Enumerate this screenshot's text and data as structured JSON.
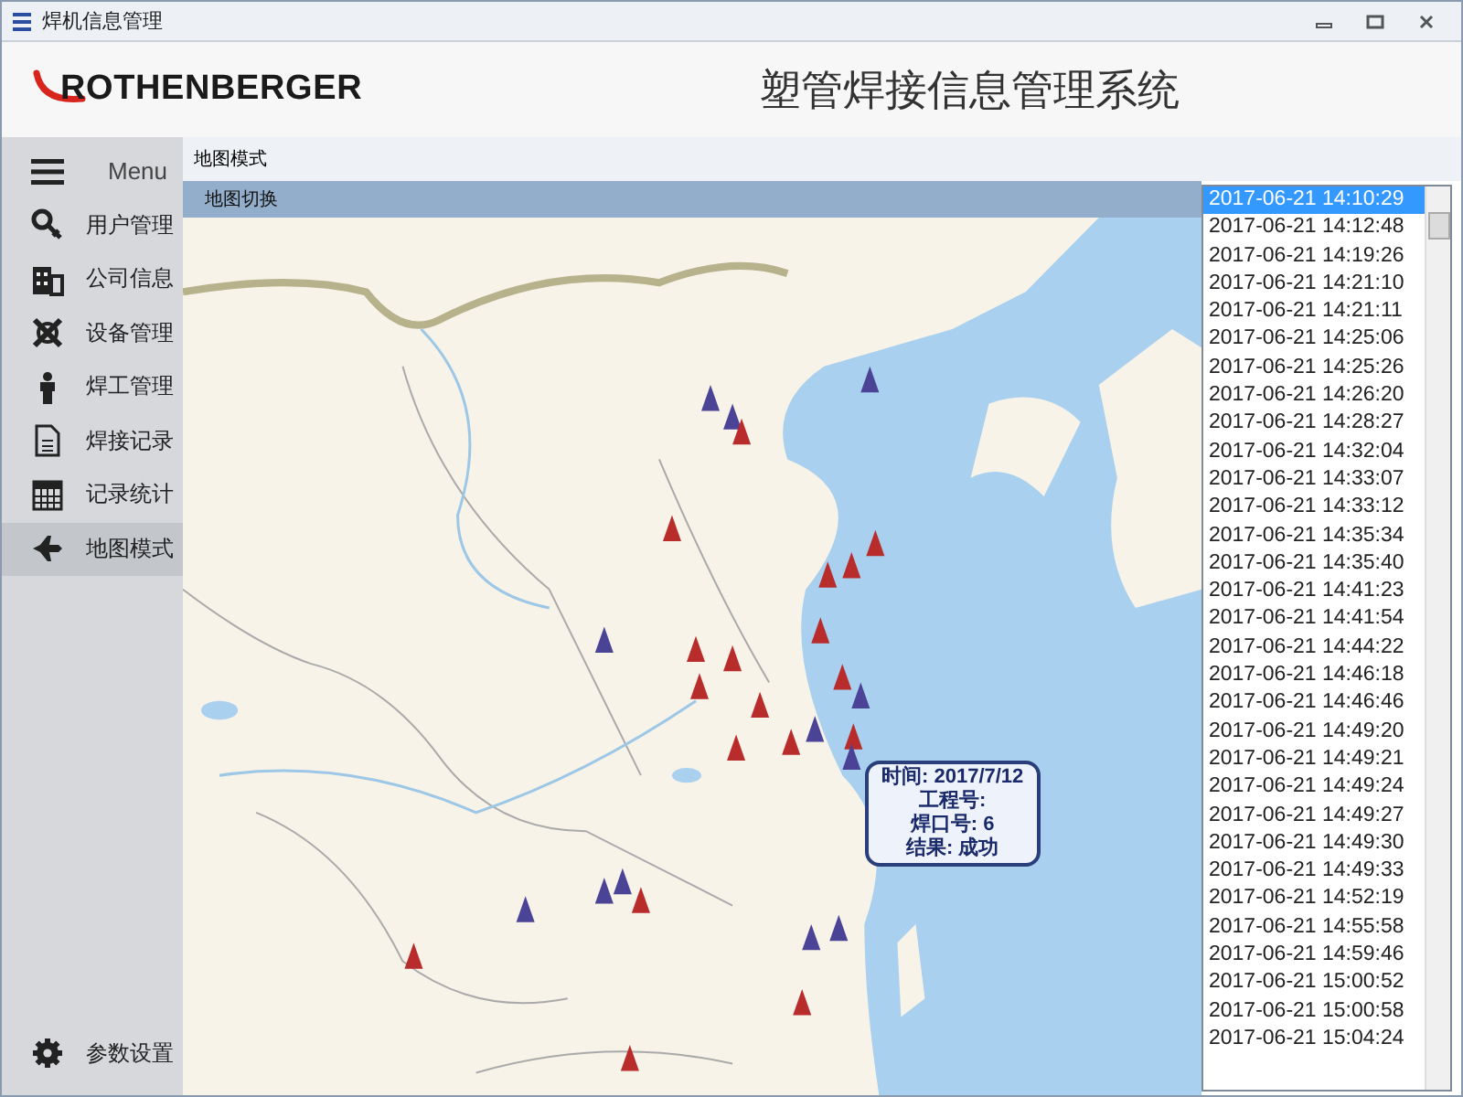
{
  "window": {
    "title": "焊机信息管理"
  },
  "header": {
    "logo": "ROTHENBERGER",
    "title": "塑管焊接信息管理系统"
  },
  "sidebar": {
    "menu_label": "Menu",
    "items": [
      {
        "label": "用户管理",
        "selected": false
      },
      {
        "label": "公司信息",
        "selected": false
      },
      {
        "label": "设备管理",
        "selected": false
      },
      {
        "label": "焊工管理",
        "selected": false
      },
      {
        "label": "焊接记录",
        "selected": false
      },
      {
        "label": "记录统计",
        "selected": false
      },
      {
        "label": "地图模式",
        "selected": true
      }
    ],
    "settings": "参数设置"
  },
  "content": {
    "breadcrumb": "地图模式",
    "toolbar": "地图切换",
    "map": {
      "kind": "picture",
      "callout": [
        "时间: 2017/7/12",
        "工程号:",
        "焊口号: 6",
        "结果: 成功"
      ]
    },
    "times": [
      {
        "label": "2017-06-21 14:10:29",
        "selected": true
      },
      {
        "label": "2017-06-21 14:12:48",
        "selected": false
      },
      {
        "label": "2017-06-21 14:19:26",
        "selected": false
      },
      {
        "label": "2017-06-21 14:21:10",
        "selected": false
      },
      {
        "label": "2017-06-21 14:21:11",
        "selected": false
      },
      {
        "label": "2017-06-21 14:25:06",
        "selected": false
      },
      {
        "label": "2017-06-21 14:25:26",
        "selected": false
      },
      {
        "label": "2017-06-21 14:26:20",
        "selected": false
      },
      {
        "label": "2017-06-21 14:28:27",
        "selected": false
      },
      {
        "label": "2017-06-21 14:32:04",
        "selected": false
      },
      {
        "label": "2017-06-21 14:33:07",
        "selected": false
      },
      {
        "label": "2017-06-21 14:33:12",
        "selected": false
      },
      {
        "label": "2017-06-21 14:35:34",
        "selected": false
      },
      {
        "label": "2017-06-21 14:35:40",
        "selected": false
      },
      {
        "label": "2017-06-21 14:41:23",
        "selected": false
      },
      {
        "label": "2017-06-21 14:41:54",
        "selected": false
      },
      {
        "label": "2017-06-21 14:44:22",
        "selected": false
      },
      {
        "label": "2017-06-21 14:46:18",
        "selected": false
      },
      {
        "label": "2017-06-21 14:46:46",
        "selected": false
      },
      {
        "label": "2017-06-21 14:49:20",
        "selected": false
      },
      {
        "label": "2017-06-21 14:49:21",
        "selected": false
      },
      {
        "label": "2017-06-21 14:49:24",
        "selected": false
      },
      {
        "label": "2017-06-21 14:49:27",
        "selected": false
      },
      {
        "label": "2017-06-21 14:49:30",
        "selected": false
      },
      {
        "label": "2017-06-21 14:49:33",
        "selected": false
      },
      {
        "label": "2017-06-21 14:52:19",
        "selected": false
      },
      {
        "label": "2017-06-21 14:55:58",
        "selected": false
      },
      {
        "label": "2017-06-21 14:59:46",
        "selected": false
      },
      {
        "label": "2017-06-21 15:00:52",
        "selected": false
      },
      {
        "label": "2017-06-21 15:00:58",
        "selected": false
      },
      {
        "label": "2017-06-21 15:04:24",
        "selected": false
      }
    ]
  }
}
